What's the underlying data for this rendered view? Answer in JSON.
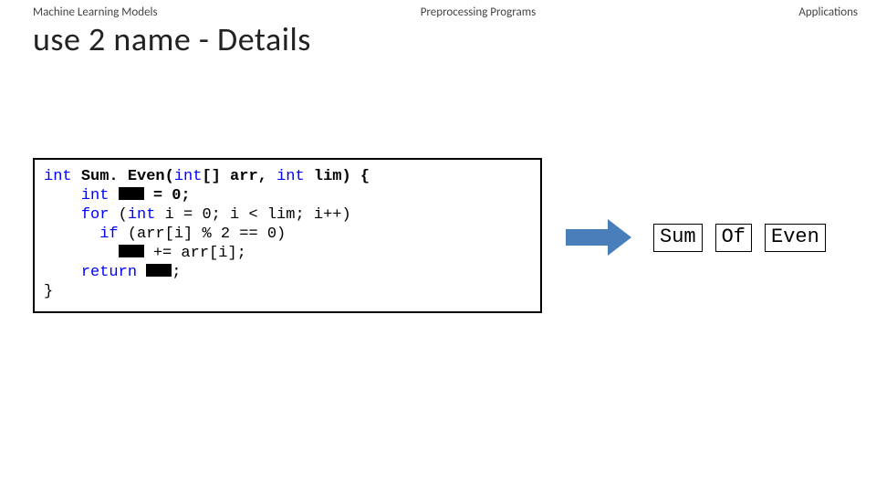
{
  "nav": {
    "left": "Machine Learning Models",
    "center": "Preprocessing Programs",
    "right": "Applications"
  },
  "title": "use 2 name - Details",
  "code": {
    "l1": {
      "kw_int": "int",
      "fn": "Sum. Even(",
      "kw_intarr": "int",
      "arr": "[] arr,",
      "kw_int2": "int",
      "lim": "lim) {"
    },
    "l2": {
      "kw_int": "int",
      "rest": "= 0;"
    },
    "l3": {
      "kw_for": "for",
      "open": "(",
      "kw_int": "int",
      "body": "i = 0; i < lim; i++)"
    },
    "l4": {
      "kw_if": "if",
      "cond": "(arr[i] % 2 == 0)"
    },
    "l5": {
      "rest": "+= arr[i];"
    },
    "l6": {
      "kw_return": "return",
      "semi": ";"
    },
    "l7": {
      "brace": "}"
    }
  },
  "labels": {
    "a": "Sum",
    "b": "Of",
    "c": "Even"
  }
}
